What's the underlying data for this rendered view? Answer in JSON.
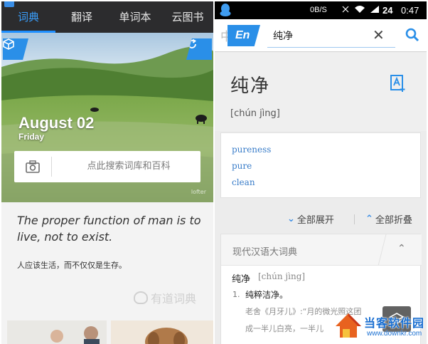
{
  "left": {
    "tabs": [
      {
        "label": "词典",
        "active": true
      },
      {
        "label": "翻译",
        "active": false
      },
      {
        "label": "单词本",
        "active": false
      },
      {
        "label": "云图书",
        "active": false
      }
    ],
    "accent": "#1e8fff",
    "photo": {
      "date": "August 02",
      "weekday": "Friday",
      "credit": "lofter"
    },
    "search": {
      "placeholder": "点此搜索词库和百科"
    },
    "quote": {
      "en": "The proper function of man is to live, not to exist.",
      "zh": "人应该生活，而不仅仅是生存。"
    },
    "brand": "有道词典"
  },
  "right": {
    "status": {
      "speed": "0B/S",
      "battery": "24",
      "time": "0:47"
    },
    "search": {
      "badge": "En",
      "query": "纯净",
      "ghost": "中"
    },
    "word": {
      "headword": "纯净",
      "pinyin": "[chún jìng]"
    },
    "meanings": [
      "pureness",
      "pure",
      "clean"
    ],
    "actions": {
      "expand": "全部展开",
      "collapse": "全部折叠"
    },
    "dict": {
      "title": "现代汉语大词典",
      "entry_word": "纯净",
      "entry_pinyin": "[chún jìng]",
      "sense_no": "1.",
      "sense": "纯粹洁净。",
      "example1": "老舍《月牙儿》:“月的微光照这团",
      "example2": "成一半儿白亮，一半儿"
    }
  },
  "watermark": {
    "title": "当客软件园",
    "url": "www.downkr.com"
  }
}
